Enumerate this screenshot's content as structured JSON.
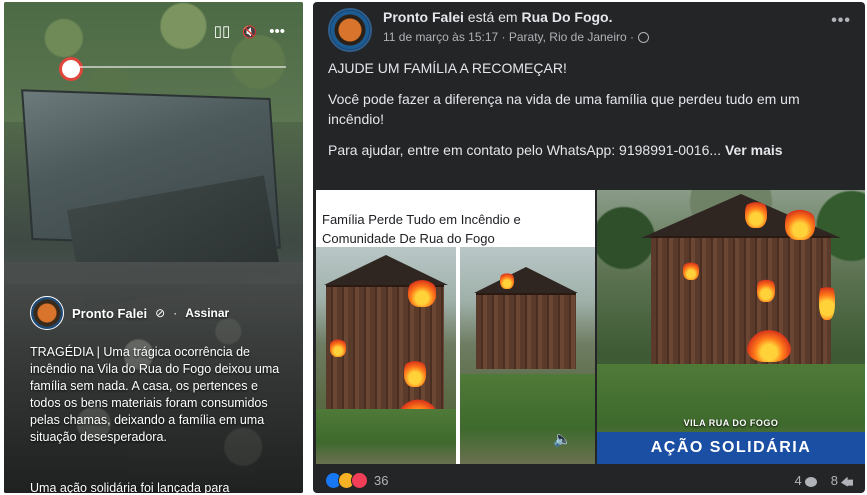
{
  "video": {
    "controls": {
      "captions_icon": "▯▯",
      "volume_icon": "🔇",
      "more_icon": "•••"
    },
    "progress": 0.02,
    "author": "Pronto Falei",
    "verified_icon": "⊘",
    "separator": "·",
    "follow_label": "Assinar",
    "caption": "TRAGÉDIA | Uma trágica ocorrência de incêndio na Vila do Rua do Fogo deixou uma família sem nada. A casa, os pertences e todos os bens materiais foram consumidos pelas chamas, deixando a família em uma situação desesperadora.",
    "caption_more": "Uma ação solidária foi lançada para"
  },
  "post": {
    "author": "Pronto Falei",
    "at_text": "está em",
    "location_page": "Rua Do Fogo.",
    "meta": "11 de março às 15:17 · Paraty, Rio de Janeiro ·",
    "more_icon": "•••",
    "paragraphs": [
      "AJUDE UM FAMÍLIA A RECOMEÇAR!",
      "Você pode fazer a diferença na vida de uma família que perdeu tudo em um incêndio!",
      "Para ajudar, entre em contato pelo WhatsApp: 9198991-0016..."
    ],
    "see_more": "Ver mais",
    "media": {
      "cut_text": "",
      "headline": "Família Perde Tudo em Incêndio e Comunidade De Rua do Fogo",
      "banner_small": "VILA RUA DO FOGO",
      "banner": "AÇÃO SOLIDÁRIA"
    },
    "reactions_count": "36",
    "comments_count": "4",
    "shares_count": "8"
  },
  "colors": {
    "post_bg": "#242526",
    "text": "#e4e6eb",
    "muted": "#b0b3b8",
    "banner": "#1b4fa3"
  }
}
